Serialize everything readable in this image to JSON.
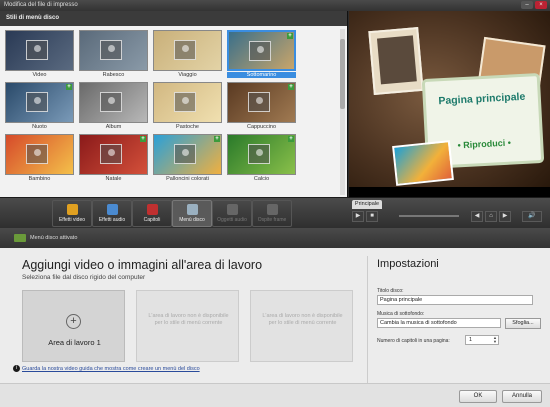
{
  "window": {
    "title": "Modifica del file di impresso"
  },
  "style_panel": {
    "header": "Stili di menù disco",
    "thumbnails": [
      {
        "label": "Video",
        "colors": [
          "#2a3a55",
          "#5a6a80"
        ],
        "selected": false,
        "has_plus": false
      },
      {
        "label": "Rabesco",
        "colors": [
          "#5a6a7a",
          "#8a9aa8"
        ],
        "selected": false,
        "has_plus": false
      },
      {
        "label": "Viaggio",
        "colors": [
          "#c9b07a",
          "#e3d3a6"
        ],
        "selected": false,
        "has_plus": false
      },
      {
        "label": "Sottomarino",
        "colors": [
          "#3a6f8a",
          "#c9a56a"
        ],
        "selected": true,
        "has_plus": true
      },
      {
        "label": "Nuoto",
        "colors": [
          "#2a4a6a",
          "#7a9ab8"
        ],
        "selected": false,
        "has_plus": true
      },
      {
        "label": "Album",
        "colors": [
          "#6a6a6a",
          "#b8b8b8"
        ],
        "selected": false,
        "has_plus": false
      },
      {
        "label": "Pastoche",
        "colors": [
          "#d2b882",
          "#f0e0b0"
        ],
        "selected": false,
        "has_plus": false
      },
      {
        "label": "Cappuccino",
        "colors": [
          "#5a3a22",
          "#a07a52"
        ],
        "selected": false,
        "has_plus": true
      },
      {
        "label": "Bambino",
        "colors": [
          "#d64a2a",
          "#f4c04a"
        ],
        "selected": false,
        "has_plus": false
      },
      {
        "label": "Natale",
        "colors": [
          "#8a1a1a",
          "#d4503a"
        ],
        "selected": false,
        "has_plus": true
      },
      {
        "label": "Palloncini colorati",
        "colors": [
          "#2aa0d8",
          "#f0b040"
        ],
        "selected": false,
        "has_plus": true
      },
      {
        "label": "Calcio",
        "colors": [
          "#2a7a2a",
          "#8ac04a"
        ],
        "selected": false,
        "has_plus": true
      }
    ]
  },
  "preview": {
    "title": "Pagina principale",
    "play_label": "• Riproduci •"
  },
  "toolbar": {
    "tools": [
      {
        "label": "Effetti video",
        "icon": "film-icon",
        "color": "#e0a020",
        "state": "normal"
      },
      {
        "label": "Effetti audio",
        "icon": "speaker-icon",
        "color": "#4a8ad0",
        "state": "normal"
      },
      {
        "label": "Capitoli",
        "icon": "chapter-icon",
        "color": "#c03030",
        "state": "normal"
      },
      {
        "label": "Menù disco",
        "icon": "disc-menu-icon",
        "color": "#9ab0c0",
        "state": "active"
      },
      {
        "label": "Oggetti audio",
        "icon": "audio-objects-icon",
        "color": "#666",
        "state": "disabled"
      },
      {
        "label": "Ospite frame",
        "icon": "frame-icon",
        "color": "#666",
        "state": "disabled"
      }
    ],
    "player": {
      "tab": "Principale",
      "play_icon": "▶",
      "stop_icon": "■",
      "prev_icon": "◀",
      "home_icon": "⌂",
      "next_icon": "▶",
      "volume_icon": "🔊"
    }
  },
  "lower": {
    "header": "Menù disco attivato",
    "add_title": "Aggiungi video o immagini all'area di lavoro",
    "add_subtitle": "Seleziona file dal disco rigido del computer",
    "areas": {
      "first_label": "Area di lavoro 1",
      "unavailable_text": "L'area di lavoro non è disponibile per lo stile di menù corrente"
    },
    "info_link": "Guarda la nostra video guida che mostra come creare un menù del disco"
  },
  "settings": {
    "title": "Impostazioni",
    "disc_title_label": "Titolo disco:",
    "disc_title_value": "Pagina principale",
    "music_label": "Musica di sottofondo:",
    "music_value": "Cambia la musica di sottofondo",
    "browse_label": "Sfoglia...",
    "chapters_label": "Numero di capitoli in una pagina:",
    "chapters_value": "1"
  },
  "footer": {
    "ok_label": "OK",
    "cancel_label": "Annulla"
  }
}
